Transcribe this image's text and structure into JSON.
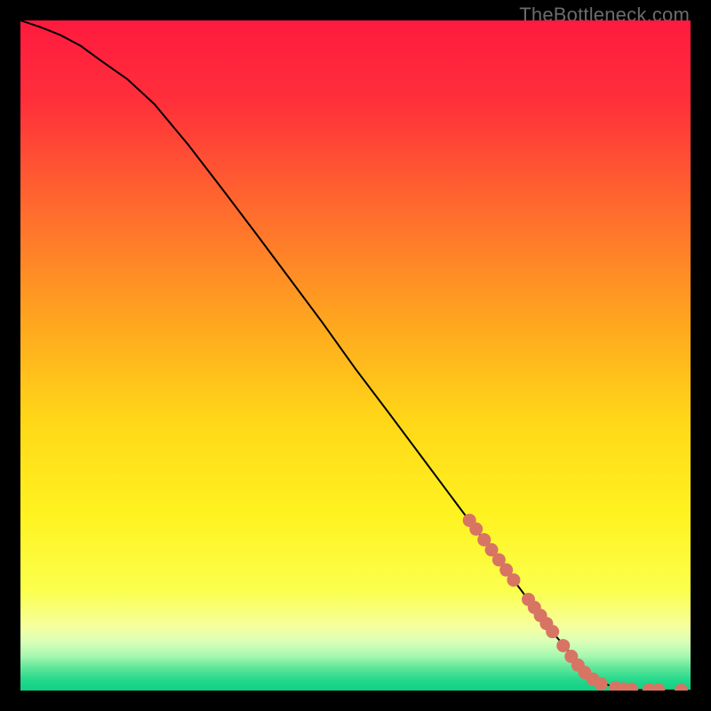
{
  "watermark": "TheBottleneck.com",
  "colors": {
    "gradient_stops": [
      {
        "offset": 0.0,
        "color": "#ff1a3f"
      },
      {
        "offset": 0.12,
        "color": "#ff2f3a"
      },
      {
        "offset": 0.28,
        "color": "#ff6a2e"
      },
      {
        "offset": 0.45,
        "color": "#ffa61f"
      },
      {
        "offset": 0.6,
        "color": "#ffd817"
      },
      {
        "offset": 0.74,
        "color": "#fff321"
      },
      {
        "offset": 0.85,
        "color": "#fbff4d"
      },
      {
        "offset": 0.905,
        "color": "#f6ffa0"
      },
      {
        "offset": 0.928,
        "color": "#d8ffb8"
      },
      {
        "offset": 0.948,
        "color": "#a8f8b0"
      },
      {
        "offset": 0.965,
        "color": "#63e79b"
      },
      {
        "offset": 0.985,
        "color": "#21d88a"
      },
      {
        "offset": 1.0,
        "color": "#12cf84"
      }
    ],
    "curve": "#000000",
    "markers": "#d87464",
    "frame": "#000000"
  },
  "chart_data": {
    "type": "line",
    "title": "",
    "xlabel": "",
    "ylabel": "",
    "xlim": [
      0,
      100
    ],
    "ylim": [
      0,
      100
    ],
    "grid": false,
    "legend": false,
    "series": [
      {
        "name": "curve",
        "x": [
          0,
          3,
          6,
          9,
          12,
          16,
          20,
          25,
          30,
          35,
          40,
          45,
          50,
          55,
          60,
          65,
          70,
          75,
          80,
          85,
          88,
          90,
          92,
          94,
          96,
          98,
          100
        ],
        "y": [
          100,
          99,
          97.8,
          96.2,
          94,
          91.2,
          87.5,
          81.5,
          75,
          68.4,
          61.7,
          55,
          48,
          41.4,
          34.7,
          28,
          21.3,
          14.6,
          8,
          2.1,
          0.7,
          0.25,
          0.1,
          0.05,
          0.02,
          0.01,
          0.005
        ]
      }
    ],
    "markers": {
      "name": "highlighted-points",
      "points": [
        {
          "x": 67.0,
          "y": 25.4
        },
        {
          "x": 68.0,
          "y": 24.1
        },
        {
          "x": 69.2,
          "y": 22.5
        },
        {
          "x": 70.3,
          "y": 21.0
        },
        {
          "x": 71.4,
          "y": 19.5
        },
        {
          "x": 72.5,
          "y": 18.0
        },
        {
          "x": 73.6,
          "y": 16.5
        },
        {
          "x": 75.8,
          "y": 13.6
        },
        {
          "x": 76.7,
          "y": 12.4
        },
        {
          "x": 77.6,
          "y": 11.2
        },
        {
          "x": 78.5,
          "y": 10.0
        },
        {
          "x": 79.4,
          "y": 8.8
        },
        {
          "x": 81.0,
          "y": 6.7
        },
        {
          "x": 82.2,
          "y": 5.1
        },
        {
          "x": 83.2,
          "y": 3.8
        },
        {
          "x": 84.2,
          "y": 2.7
        },
        {
          "x": 85.4,
          "y": 1.7
        },
        {
          "x": 86.6,
          "y": 1.0
        },
        {
          "x": 88.8,
          "y": 0.4
        },
        {
          "x": 90.0,
          "y": 0.25
        },
        {
          "x": 91.2,
          "y": 0.18
        },
        {
          "x": 93.8,
          "y": 0.1
        },
        {
          "x": 95.2,
          "y": 0.08
        },
        {
          "x": 98.6,
          "y": 0.03
        }
      ]
    }
  }
}
